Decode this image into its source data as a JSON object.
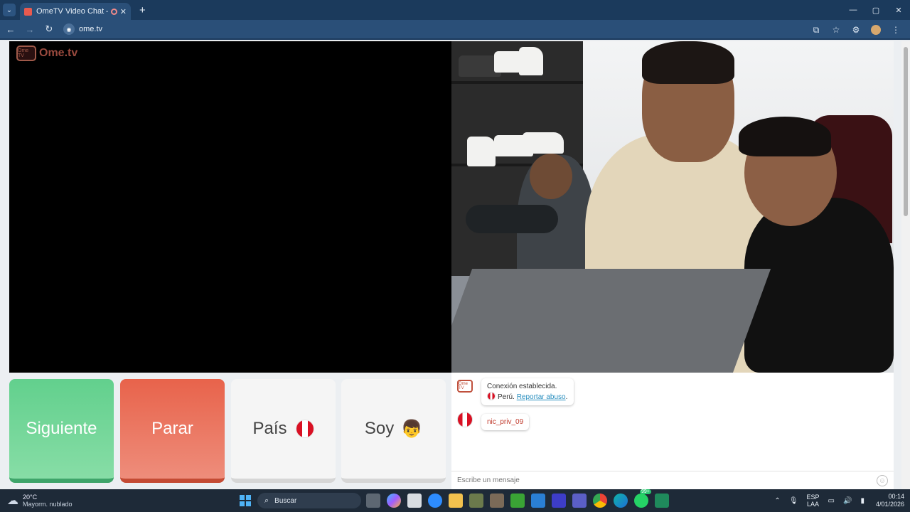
{
  "browser": {
    "tab_title": "OmeTV Video Chat — Ome",
    "tab_close": "✕",
    "new_tab": "+",
    "url": "ome.tv",
    "window": {
      "minimize": "—",
      "maximize": "▢",
      "close": "✕"
    }
  },
  "page": {
    "logo_text": "Ome.tv",
    "logo_badge": "Ome TV",
    "buttons": {
      "next": "Siguiente",
      "stop": "Parar",
      "country": "País",
      "gender": "Soy"
    },
    "chat": {
      "system_line1": "Conexión establecida.",
      "system_country": "Perú.",
      "report_link": "Reportar abuso",
      "report_suffix": ".",
      "username": "nic_priv_09",
      "input_placeholder": "Escribe un mensaje"
    }
  },
  "taskbar": {
    "temperature": "20°C",
    "weather_desc": "Mayorm. nublado",
    "search_label": "Buscar",
    "lang_top": "ESP",
    "lang_bottom": "LAA",
    "time": "00:14",
    "date": "4/01/2026",
    "badge": "99+"
  },
  "colors": {
    "next": "#62d08d",
    "stop": "#e8634b",
    "browser_frame": "#1b3a5c"
  }
}
